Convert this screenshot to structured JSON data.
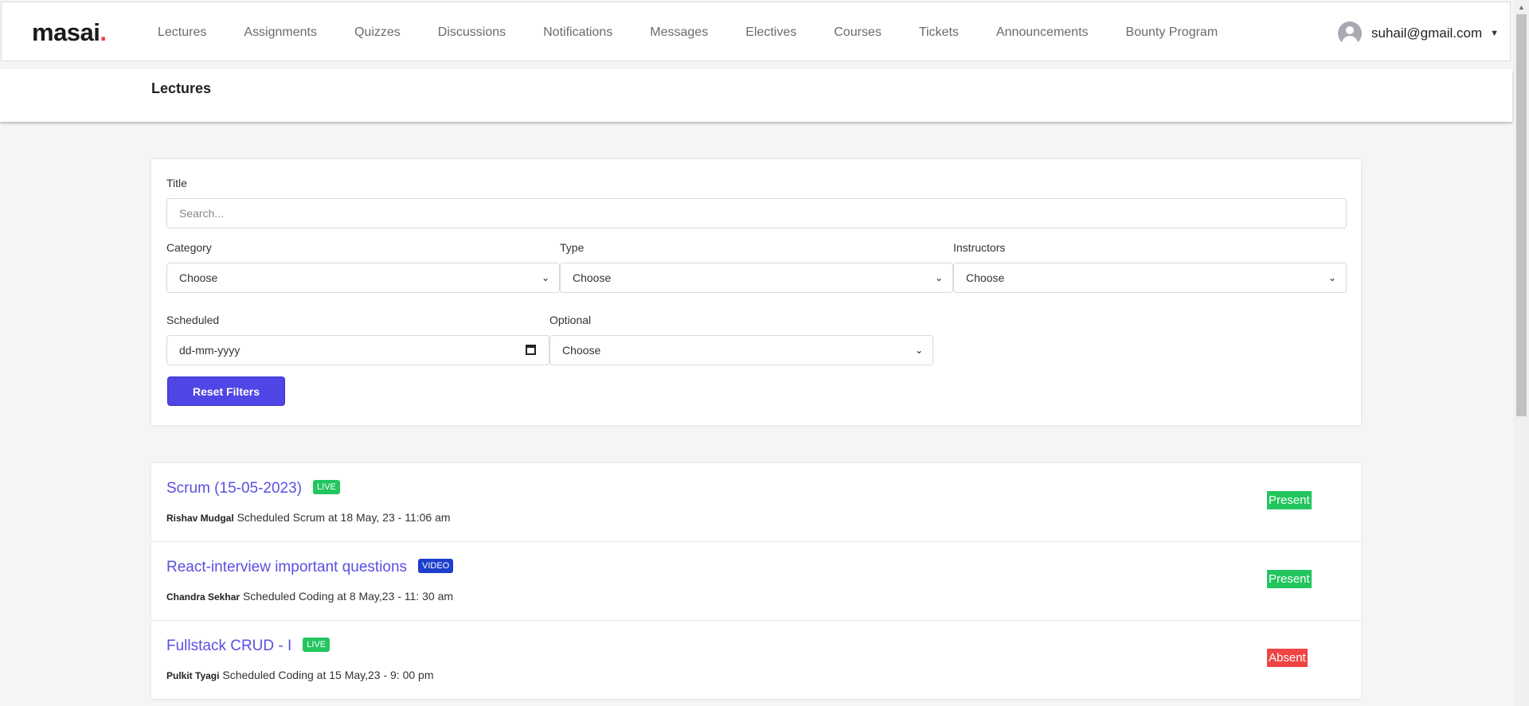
{
  "brand": {
    "name": "masai",
    "dot": "."
  },
  "nav": [
    "Lectures",
    "Assignments",
    "Quizzes",
    "Discussions",
    "Notifications",
    "Messages",
    "Electives",
    "Courses",
    "Tickets",
    "Announcements",
    "Bounty Program"
  ],
  "user": {
    "email": "suhail@gmail.com",
    "icon": "user-avatar-icon"
  },
  "page": {
    "title": "Lectures"
  },
  "filters": {
    "title_label": "Title",
    "title_placeholder": "Search...",
    "category_label": "Category",
    "category_value": "Choose",
    "type_label": "Type",
    "type_value": "Choose",
    "instructors_label": "Instructors",
    "instructors_value": "Choose",
    "scheduled_label": "Scheduled",
    "scheduled_placeholder": "dd-mm-yyyy",
    "optional_label": "Optional",
    "optional_value": "Choose",
    "reset_label": "Reset Filters"
  },
  "lectures": [
    {
      "title": "Scrum (15-05-2023)",
      "badge": "LIVE",
      "instructor": "Rishav Mudgal",
      "detail": "Scheduled Scrum at 18 May, 23 - 11:06 am",
      "status": "Present"
    },
    {
      "title": "React-interview important questions",
      "badge": "VIDEO",
      "instructor": "Chandra Sekhar",
      "detail": "Scheduled Coding at 8 May,23 - 11: 30 am",
      "status": "Present"
    },
    {
      "title": "Fullstack CRUD - I",
      "badge": "LIVE",
      "instructor": "Pulkit Tyagi",
      "detail": "Scheduled Coding at 15 May,23 - 9: 00 pm",
      "status": "Absent"
    }
  ],
  "colors": {
    "accent": "#4f46e5",
    "live": "#22c55e",
    "video": "#1d3fcc",
    "present": "#22c55e",
    "absent": "#ef4444",
    "title_link": "#5a4fe0"
  }
}
